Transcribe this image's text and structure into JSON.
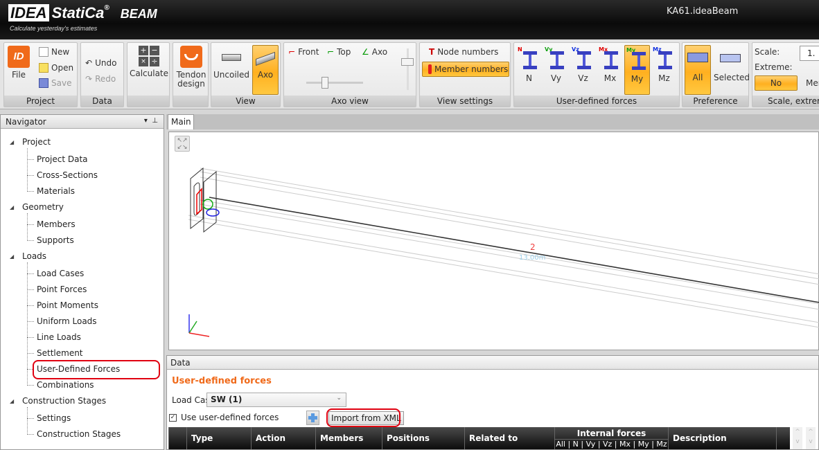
{
  "app": {
    "logo_brand": "IDEA StatiCa",
    "logo_product": "BEAM",
    "tagline": "Calculate yesterday's estimates",
    "window_title": "KA61.ideaBeam"
  },
  "ribbon": {
    "project": {
      "label": "Project",
      "file": "File",
      "new": "New",
      "open": "Open",
      "save": "Save"
    },
    "data": {
      "label": "Data",
      "undo": "Undo",
      "redo": "Redo"
    },
    "calculate": {
      "label": "Calculate"
    },
    "tendon": {
      "label": "Tendon design"
    },
    "view": {
      "label": "View",
      "uncoiled": "Uncoiled",
      "axo": "Axo"
    },
    "axo_view": {
      "label": "Axo view",
      "front": "Front",
      "top": "Top",
      "axo": "Axo"
    },
    "view_settings": {
      "label": "View settings",
      "node_numbers": "Node numbers",
      "member_numbers": "Member numbers"
    },
    "forces": {
      "label": "User-defined forces",
      "items": [
        {
          "label": "N",
          "tag": "N",
          "color": "#e00000"
        },
        {
          "label": "Vy",
          "tag": "Vy",
          "color": "#10a010"
        },
        {
          "label": "Vz",
          "tag": "Vz",
          "color": "#1030e0"
        },
        {
          "label": "Mx",
          "tag": "Mx",
          "color": "#e00000"
        },
        {
          "label": "My",
          "tag": "My",
          "color": "#10a010"
        },
        {
          "label": "Mz",
          "tag": "Mz",
          "color": "#1030e0"
        }
      ],
      "selected": "My"
    },
    "preference": {
      "label": "Preference",
      "all": "All",
      "selected": "Selected"
    },
    "scale": {
      "label": "Scale, extrem",
      "scale_label": "Scale:",
      "scale_value": "1.",
      "extreme_label": "Extreme:",
      "extreme_value": "No",
      "members_partial": "Mer"
    }
  },
  "navigator": {
    "title": "Navigator",
    "groups": [
      {
        "label": "Project",
        "items": [
          "Project Data",
          "Cross-Sections",
          "Materials"
        ]
      },
      {
        "label": "Geometry",
        "items": [
          "Members",
          "Supports"
        ]
      },
      {
        "label": "Loads",
        "items": [
          "Load Cases",
          "Point Forces",
          "Point Moments",
          "Uniform Loads",
          "Line Loads",
          "Settlement",
          "User-Defined Forces",
          "Combinations"
        ]
      },
      {
        "label": "Construction Stages",
        "items": [
          "Settings",
          "Construction Stages"
        ]
      }
    ],
    "active": "User-Defined Forces"
  },
  "main": {
    "tab": "Main",
    "member_number": "2",
    "member_length": "13.00m"
  },
  "data_panel": {
    "title": "Data",
    "section_title": "User-defined forces",
    "load_case_label": "Load Case",
    "load_case_value": "SW (1)",
    "use_forces_label": "Use user-defined forces",
    "use_forces_checked": true,
    "import_button": "Import from XML",
    "columns": [
      "Type",
      "Action",
      "Members",
      "Positions",
      "Related to",
      "Internal forces",
      "Description"
    ],
    "internal_forces_sub": "All | N | Vy | Vz | Mx | My | Mz"
  },
  "colors": {
    "accent_orange": "#f06a1a",
    "selected_bg": "#ffb020",
    "highlight_ring": "#e00010"
  }
}
